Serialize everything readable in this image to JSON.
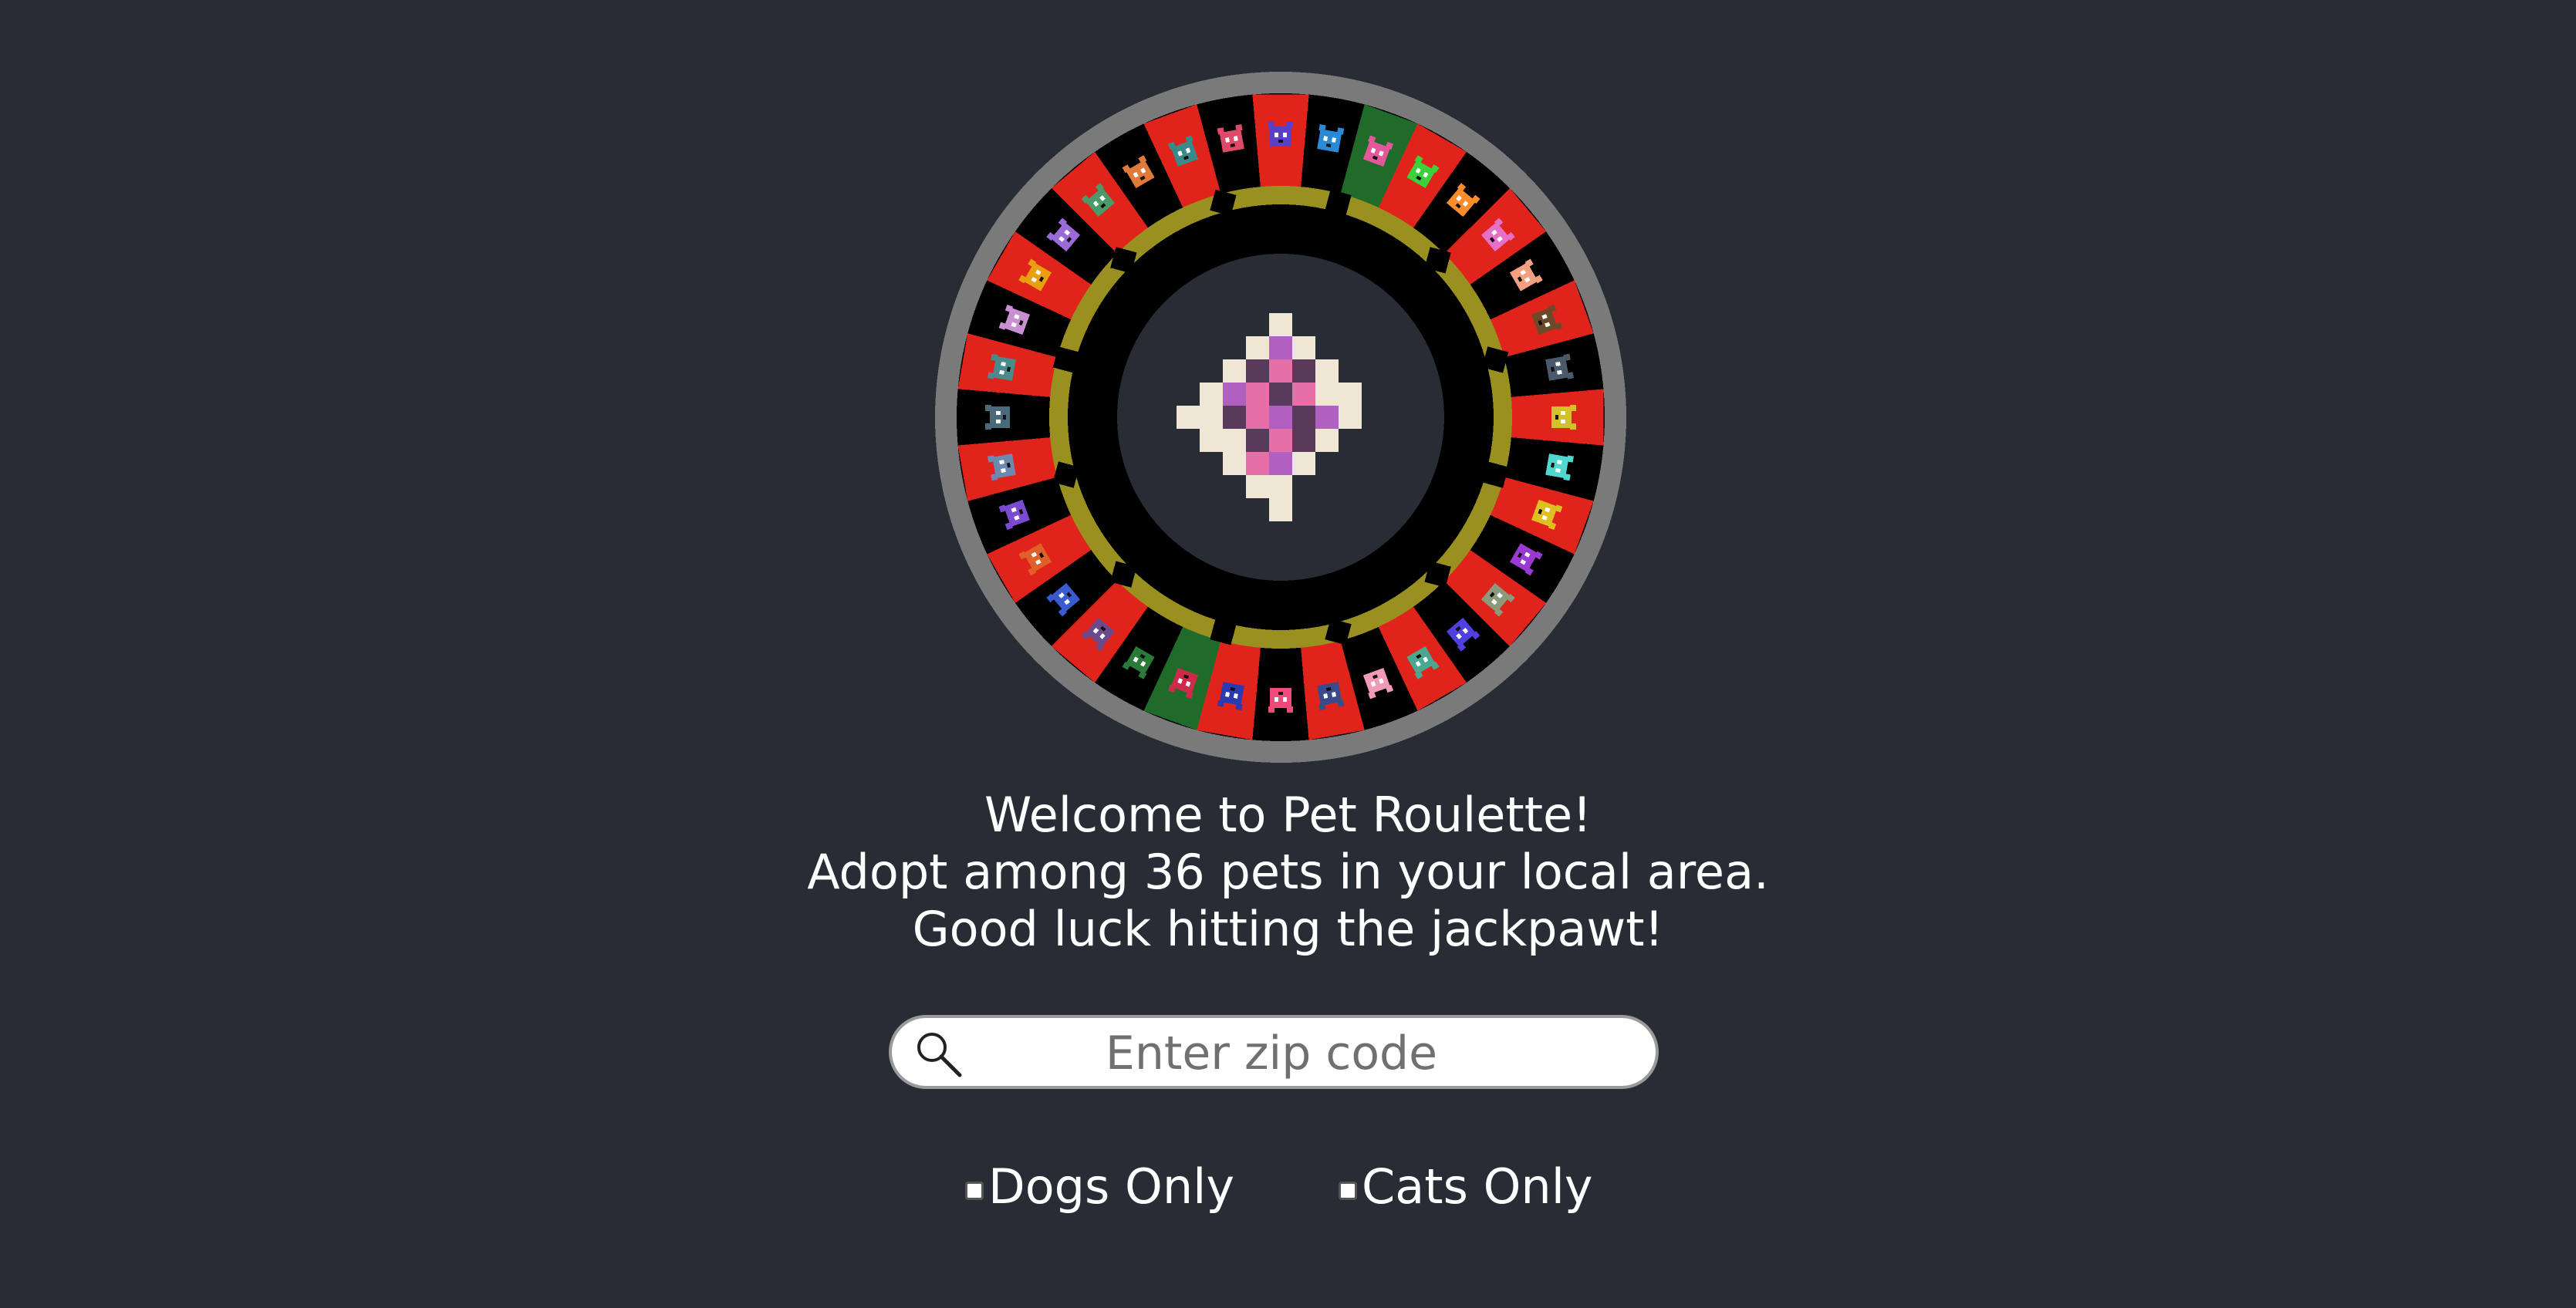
{
  "welcome": {
    "line1": "Welcome to Pet Roulette!",
    "line2": "Adopt among 36 pets in your local area.",
    "line3": "Good luck hitting the jackpawt!"
  },
  "search": {
    "placeholder": "Enter zip code",
    "value": ""
  },
  "filters": {
    "dogs_label": "Dogs Only",
    "dogs_checked": false,
    "cats_label": "Cats Only",
    "cats_checked": false
  },
  "wheel": {
    "pocket_count": 36,
    "rotation_deg": 15,
    "colors": {
      "rim": "#7a7a7a",
      "red": "#e0241b",
      "black": "#000000",
      "green": "#1f6b2a",
      "gold": "#9a9020",
      "center_bg": "#282c34"
    },
    "pockets": [
      {
        "kind": "green",
        "pet_color": "#e4579a"
      },
      {
        "kind": "red",
        "pet_color": "#3ad13a"
      },
      {
        "kind": "black",
        "pet_color": "#ff8c2a"
      },
      {
        "kind": "red",
        "pet_color": "#e66fc8"
      },
      {
        "kind": "black",
        "pet_color": "#f4a080"
      },
      {
        "kind": "red",
        "pet_color": "#6b4a2a"
      },
      {
        "kind": "black",
        "pet_color": "#4a5a6a"
      },
      {
        "kind": "red",
        "pet_color": "#d4c12a"
      },
      {
        "kind": "black",
        "pet_color": "#50d8d0"
      },
      {
        "kind": "red",
        "pet_color": "#e0c020"
      },
      {
        "kind": "black",
        "pet_color": "#9a3ad0"
      },
      {
        "kind": "red",
        "pet_color": "#8a9a7a"
      },
      {
        "kind": "black",
        "pet_color": "#5040e0"
      },
      {
        "kind": "red",
        "pet_color": "#4aa890"
      },
      {
        "kind": "black",
        "pet_color": "#f09ab8"
      },
      {
        "kind": "red",
        "pet_color": "#3a4a8a"
      },
      {
        "kind": "black",
        "pet_color": "#f04a7a"
      },
      {
        "kind": "red",
        "pet_color": "#2a3ab0"
      },
      {
        "kind": "green",
        "pet_color": "#d02a4a"
      },
      {
        "kind": "black",
        "pet_color": "#2a7a3a"
      },
      {
        "kind": "red",
        "pet_color": "#6a4a8a"
      },
      {
        "kind": "black",
        "pet_color": "#3a5ad0"
      },
      {
        "kind": "red",
        "pet_color": "#e0602a"
      },
      {
        "kind": "black",
        "pet_color": "#7a4ad0"
      },
      {
        "kind": "red",
        "pet_color": "#6a8ab0"
      },
      {
        "kind": "black",
        "pet_color": "#4a6a7a"
      },
      {
        "kind": "red",
        "pet_color": "#4a8a8a"
      },
      {
        "kind": "black",
        "pet_color": "#c890d0"
      },
      {
        "kind": "red",
        "pet_color": "#e8a010"
      },
      {
        "kind": "black",
        "pet_color": "#9a6ad8"
      },
      {
        "kind": "red",
        "pet_color": "#4a9a6a"
      },
      {
        "kind": "black",
        "pet_color": "#e07a3a"
      },
      {
        "kind": "red",
        "pet_color": "#3a8a8a"
      },
      {
        "kind": "black",
        "pet_color": "#e04a6a"
      },
      {
        "kind": "red",
        "pet_color": "#5a40c8"
      },
      {
        "kind": "black",
        "pet_color": "#2a8ad8"
      }
    ],
    "center": {
      "cream": "#efe6d6",
      "pink": "#e66fa8",
      "purple": "#b060c0",
      "dark": "#5a3a5a"
    }
  }
}
